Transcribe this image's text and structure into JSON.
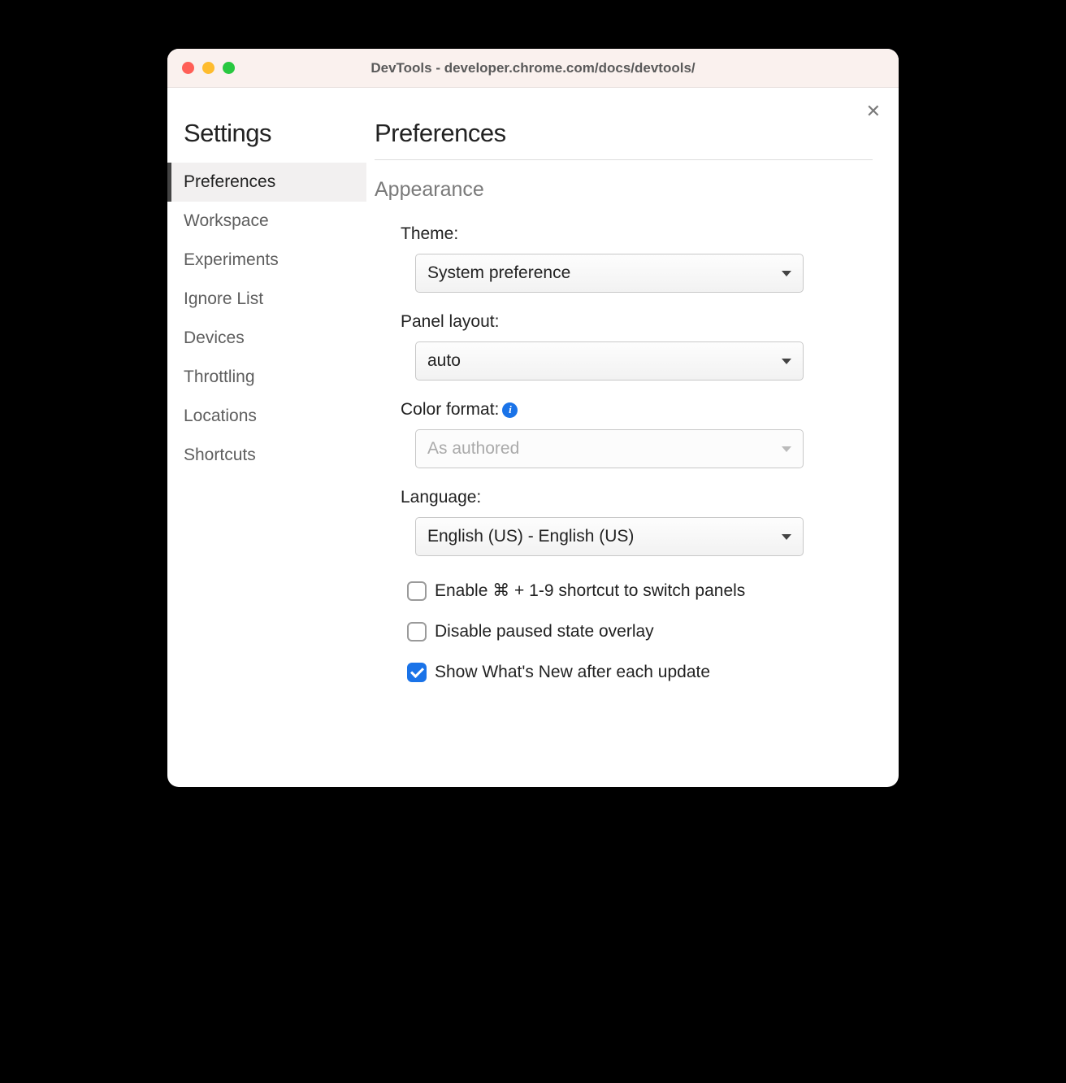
{
  "window": {
    "title": "DevTools - developer.chrome.com/docs/devtools/"
  },
  "sidebar": {
    "title": "Settings",
    "items": [
      {
        "label": "Preferences",
        "active": true
      },
      {
        "label": "Workspace",
        "active": false
      },
      {
        "label": "Experiments",
        "active": false
      },
      {
        "label": "Ignore List",
        "active": false
      },
      {
        "label": "Devices",
        "active": false
      },
      {
        "label": "Throttling",
        "active": false
      },
      {
        "label": "Locations",
        "active": false
      },
      {
        "label": "Shortcuts",
        "active": false
      }
    ]
  },
  "main": {
    "title": "Preferences",
    "section": "Appearance",
    "fields": {
      "theme": {
        "label": "Theme:",
        "value": "System preference"
      },
      "panel_layout": {
        "label": "Panel layout:",
        "value": "auto"
      },
      "color_format": {
        "label": "Color format:",
        "value": "As authored",
        "disabled": true,
        "has_info": true
      },
      "language": {
        "label": "Language:",
        "value": "English (US) - English (US)"
      }
    },
    "checkboxes": [
      {
        "label": "Enable ⌘ + 1-9 shortcut to switch panels",
        "checked": false
      },
      {
        "label": "Disable paused state overlay",
        "checked": false
      },
      {
        "label": "Show What's New after each update",
        "checked": true
      }
    ]
  }
}
